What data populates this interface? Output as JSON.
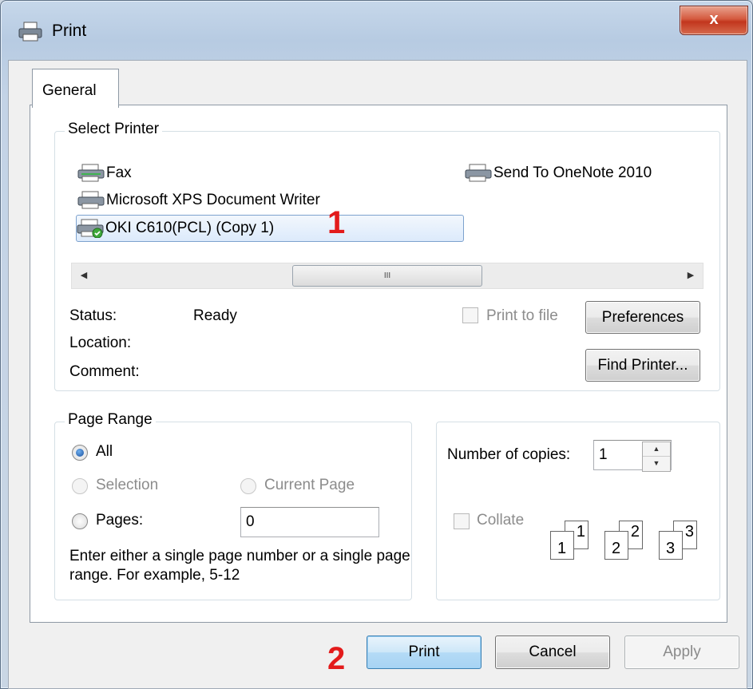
{
  "window": {
    "title": "Print",
    "close_label": "x"
  },
  "tabs": [
    {
      "label": "General"
    }
  ],
  "select_printer": {
    "group_label": "Select Printer",
    "printers": [
      {
        "label": "Fax"
      },
      {
        "label": "Send To OneNote 2010"
      },
      {
        "label": "Microsoft XPS Document Writer"
      },
      {
        "label": "OKI C610(PCL) (Copy 1)",
        "selected": true
      }
    ],
    "status_label": "Status:",
    "status_value": "Ready",
    "location_label": "Location:",
    "comment_label": "Comment:",
    "print_to_file_label": "Print to file",
    "preferences_label": "Preferences",
    "find_printer_label": "Find Printer...",
    "scrollbar_grip": "III"
  },
  "page_range": {
    "group_label": "Page Range",
    "all_label": "All",
    "selection_label": "Selection",
    "current_page_label": "Current Page",
    "pages_label": "Pages:",
    "pages_value": "0",
    "hint": "Enter either a single page number or a single page range.  For example, 5-12"
  },
  "copies": {
    "number_label": "Number of copies:",
    "number_value": "1",
    "collate_label": "Collate",
    "collate_pages": [
      "1",
      "1",
      "2",
      "2",
      "3",
      "3"
    ]
  },
  "buttons": {
    "print": "Print",
    "cancel": "Cancel",
    "apply": "Apply"
  },
  "annotations": {
    "marker_1": "1",
    "marker_2": "2"
  },
  "colors": {
    "accent": "#3c7fb1",
    "marker": "#e31b1b"
  }
}
